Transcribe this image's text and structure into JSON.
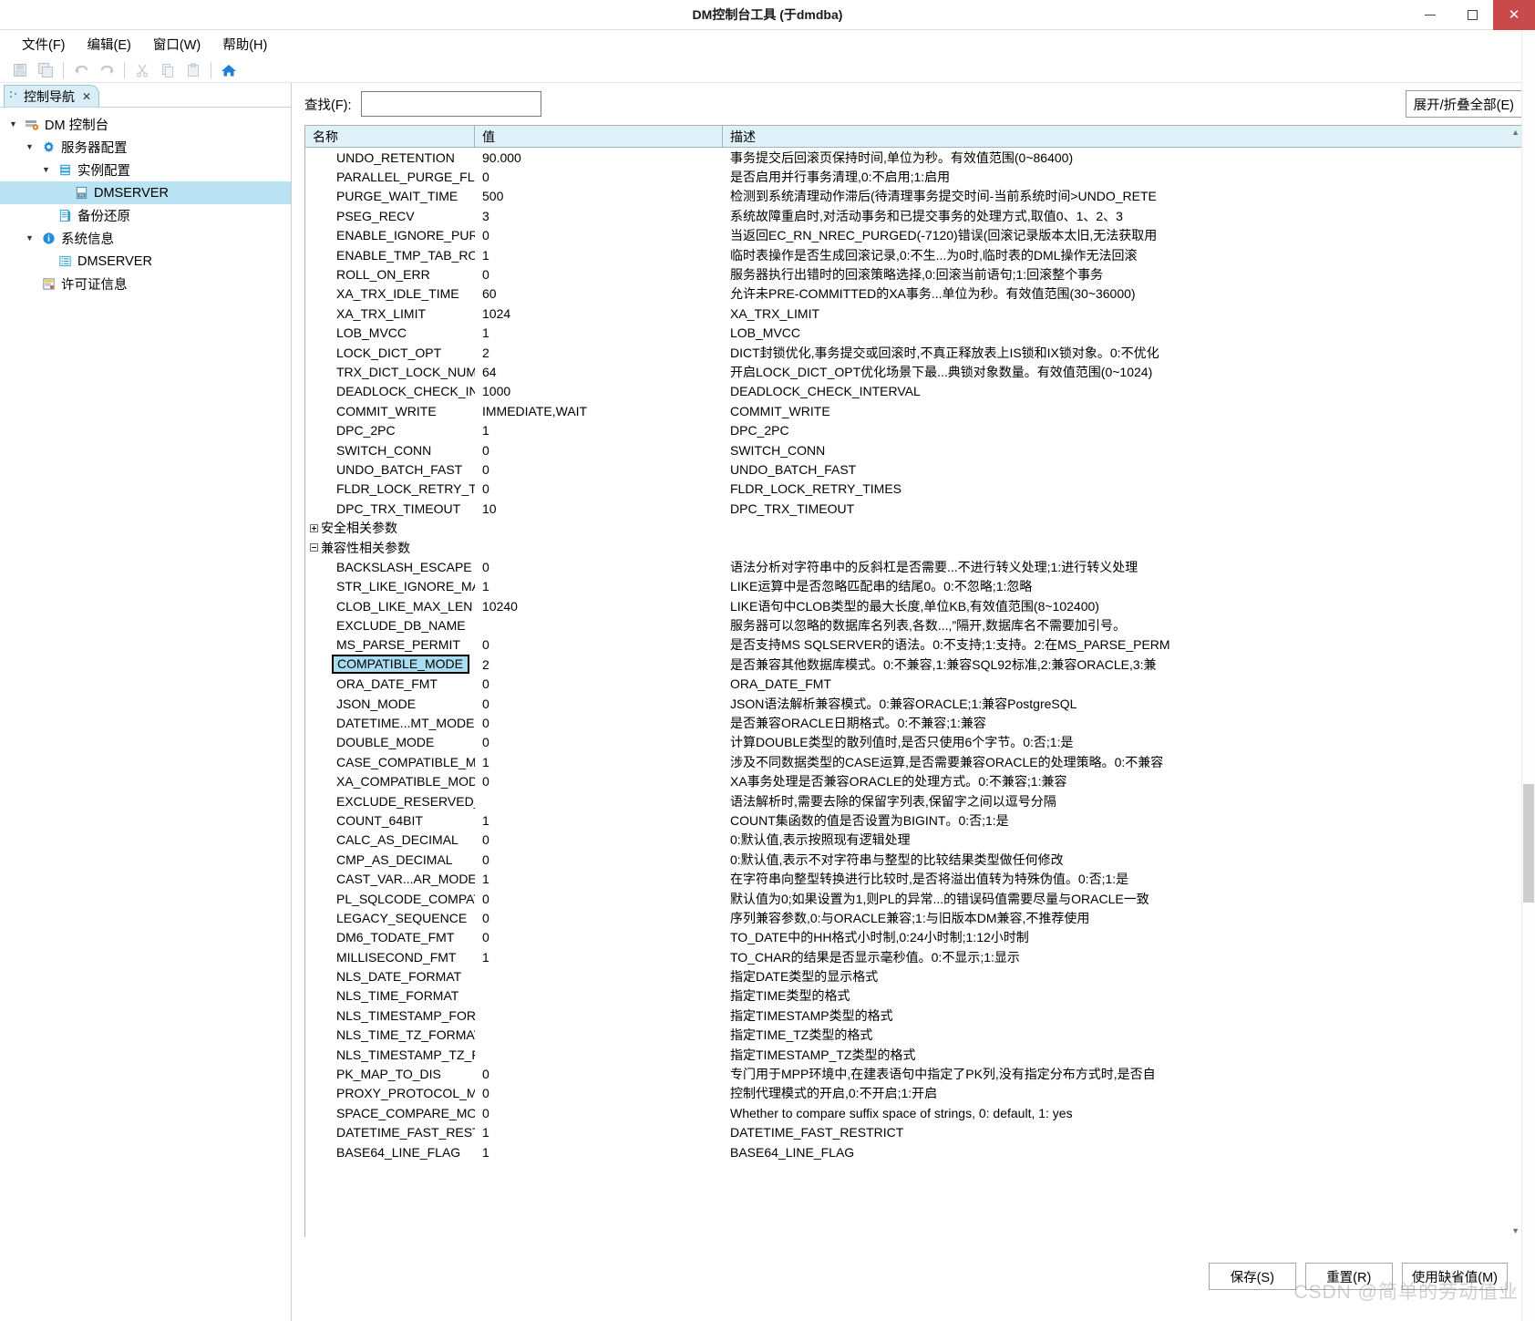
{
  "window": {
    "title": "DM控制台工具 (于dmdba)",
    "minimize_label": "minimize",
    "maximize_label": "maximize",
    "close_label": "✕"
  },
  "menubar": [
    {
      "label": "文件(F)"
    },
    {
      "label": "编辑(E)"
    },
    {
      "label": "窗口(W)"
    },
    {
      "label": "帮助(H)"
    }
  ],
  "toolbar": {
    "items": [
      {
        "icon": "save-icon",
        "enabled": false
      },
      {
        "icon": "save-all-icon",
        "enabled": false
      },
      {
        "icon": "undo-icon",
        "enabled": false
      },
      {
        "icon": "redo-icon",
        "enabled": false
      },
      {
        "icon": "cut-icon",
        "enabled": false
      },
      {
        "icon": "copy-icon",
        "enabled": false
      },
      {
        "icon": "paste-icon",
        "enabled": false
      },
      {
        "icon": "home-icon",
        "enabled": true
      }
    ]
  },
  "sidebar": {
    "tab_label": "控制导航",
    "tab_close": "✕",
    "tree": [
      {
        "label": "DM 控制台",
        "indent": 0,
        "twisty": "▼",
        "icon": "console-icon",
        "selected": false
      },
      {
        "label": "服务器配置",
        "indent": 1,
        "twisty": "▼",
        "icon": "gear-icon",
        "selected": false
      },
      {
        "label": "实例配置",
        "indent": 2,
        "twisty": "▼",
        "icon": "instance-icon",
        "selected": false
      },
      {
        "label": "DMSERVER",
        "indent": 3,
        "twisty": "",
        "icon": "ini-file-icon",
        "selected": true
      },
      {
        "label": "备份还原",
        "indent": 2,
        "twisty": "",
        "icon": "backup-icon",
        "selected": false
      },
      {
        "label": "系统信息",
        "indent": 1,
        "twisty": "▼",
        "icon": "info-icon",
        "selected": false
      },
      {
        "label": "DMSERVER",
        "indent": 2,
        "twisty": "",
        "icon": "list-icon",
        "selected": false
      },
      {
        "label": "许可证信息",
        "indent": 1,
        "twisty": "",
        "icon": "license-icon",
        "selected": false
      }
    ]
  },
  "main": {
    "find_label": "查找(F):",
    "find_value": "",
    "find_placeholder": "",
    "expand_all_label": "展开/折叠全部(E)",
    "columns": {
      "name": "名称",
      "value": "值",
      "desc": "描述"
    },
    "rows": [
      {
        "type": "param",
        "name": "UNDO_RETENTION",
        "value": "90.000",
        "desc": "事务提交后回滚页保持时间,单位为秒。有效值范围(0~86400)"
      },
      {
        "type": "param",
        "name": "PARALLEL_PURGE_FLA.",
        "value": "0",
        "desc": "是否启用并行事务清理,0:不启用;1:启用"
      },
      {
        "type": "param",
        "name": "PURGE_WAIT_TIME",
        "value": "500",
        "desc": "检测到系统清理动作滞后(待清理事务提交时间-当前系统时间>UNDO_RETE"
      },
      {
        "type": "param",
        "name": "PSEG_RECV",
        "value": "3",
        "desc": "系统故障重启时,对活动事务和已提交事务的处理方式,取值0、1、2、3"
      },
      {
        "type": "param",
        "name": "ENABLE_IGNORE_PUR(",
        "value": "0",
        "desc": "当返回EC_RN_NREC_PURGED(-7120)错误(回滚记录版本太旧,无法获取用"
      },
      {
        "type": "param",
        "name": "ENABLE_TMP_TAB_ROl",
        "value": "1",
        "desc": "临时表操作是否生成回滚记录,0:不生...为0时,临时表的DML操作无法回滚"
      },
      {
        "type": "param",
        "name": "ROLL_ON_ERR",
        "value": "0",
        "desc": "服务器执行出错时的回滚策略选择,0:回滚当前语句;1:回滚整个事务"
      },
      {
        "type": "param",
        "name": "XA_TRX_IDLE_TIME",
        "value": "60",
        "desc": "允许未PRE-COMMITTED的XA事务...单位为秒。有效值范围(30~36000)"
      },
      {
        "type": "param",
        "name": "XA_TRX_LIMIT",
        "value": "1024",
        "desc": "XA_TRX_LIMIT"
      },
      {
        "type": "param",
        "name": "LOB_MVCC",
        "value": "1",
        "desc": "LOB_MVCC"
      },
      {
        "type": "param",
        "name": "LOCK_DICT_OPT",
        "value": "2",
        "desc": "DICT封锁优化,事务提交或回滚时,不真正释放表上IS锁和IX锁对象。0:不优化"
      },
      {
        "type": "param",
        "name": "TRX_DICT_LOCK_NUM",
        "value": "64",
        "desc": "开启LOCK_DICT_OPT优化场景下最...典锁对象数量。有效值范围(0~1024)"
      },
      {
        "type": "param",
        "name": "DEADLOCK_CHECK_INT",
        "value": "1000",
        "desc": "DEADLOCK_CHECK_INTERVAL"
      },
      {
        "type": "param",
        "name": "COMMIT_WRITE",
        "value": "IMMEDIATE,WAIT",
        "desc": "COMMIT_WRITE"
      },
      {
        "type": "param",
        "name": "DPC_2PC",
        "value": "1",
        "desc": "DPC_2PC"
      },
      {
        "type": "param",
        "name": "SWITCH_CONN",
        "value": "0",
        "desc": "SWITCH_CONN"
      },
      {
        "type": "param",
        "name": "UNDO_BATCH_FAST",
        "value": "0",
        "desc": "UNDO_BATCH_FAST"
      },
      {
        "type": "param",
        "name": "FLDR_LOCK_RETRY_TI..",
        "value": "0",
        "desc": "FLDR_LOCK_RETRY_TIMES"
      },
      {
        "type": "param",
        "name": "DPC_TRX_TIMEOUT",
        "value": "10",
        "desc": "DPC_TRX_TIMEOUT"
      },
      {
        "type": "group",
        "expanded": false,
        "name": "安全相关参数",
        "value": "",
        "desc": ""
      },
      {
        "type": "group",
        "expanded": true,
        "name": "兼容性相关参数",
        "value": "",
        "desc": ""
      },
      {
        "type": "param",
        "name": "BACKSLASH_ESCAPE",
        "value": "0",
        "desc": "语法分析对字符串中的反斜杠是否需要...不进行转义处理;1:进行转义处理"
      },
      {
        "type": "param",
        "name": "STR_LIKE_IGNORE_MA.",
        "value": "1",
        "desc": "LIKE运算中是否忽略匹配串的结尾0。0:不忽略;1:忽略"
      },
      {
        "type": "param",
        "name": "CLOB_LIKE_MAX_LEN",
        "value": "10240",
        "desc": "LIKE语句中CLOB类型的最大长度,单位KB,有效值范围(8~102400)"
      },
      {
        "type": "param",
        "name": "EXCLUDE_DB_NAME",
        "value": "",
        "desc": "服务器可以忽略的数据库名列表,各数...,”隔开,数据库名不需要加引号。"
      },
      {
        "type": "param",
        "name": "MS_PARSE_PERMIT",
        "value": "0",
        "desc": "是否支持MS SQLSERVER的语法。0:不支持;1:支持。2:在MS_PARSE_PERM"
      },
      {
        "type": "param",
        "name": "COMPATIBLE_MODE",
        "value": "2",
        "desc": "是否兼容其他数据库模式。0:不兼容,1:兼容SQL92标准,2:兼容ORACLE,3:兼",
        "selected": true
      },
      {
        "type": "param",
        "name": "ORA_DATE_FMT",
        "value": "0",
        "desc": "ORA_DATE_FMT"
      },
      {
        "type": "param",
        "name": "JSON_MODE",
        "value": "0",
        "desc": "JSON语法解析兼容模式。0:兼容ORACLE;1:兼容PostgreSQL"
      },
      {
        "type": "param",
        "name": "DATETIME...MT_MODE",
        "value": "0",
        "desc": "是否兼容ORACLE日期格式。0:不兼容;1:兼容"
      },
      {
        "type": "param",
        "name": "DOUBLE_MODE",
        "value": "0",
        "desc": "计算DOUBLE类型的散列值时,是否只使用6个字节。0:否;1:是"
      },
      {
        "type": "param",
        "name": "CASE_COMPATIBLE_M(",
        "value": "1",
        "desc": "涉及不同数据类型的CASE运算,是否需要兼容ORACLE的处理策略。0:不兼容"
      },
      {
        "type": "param",
        "name": "XA_COMPATIBLE_MOD",
        "value": "0",
        "desc": "XA事务处理是否兼容ORACLE的处理方式。0:不兼容;1:兼容"
      },
      {
        "type": "param",
        "name": "EXCLUDE_RESERVED_V",
        "value": "",
        "desc": "语法解析时,需要去除的保留字列表,保留字之间以逗号分隔"
      },
      {
        "type": "param",
        "name": "COUNT_64BIT",
        "value": "1",
        "desc": "COUNT集函数的值是否设置为BIGINT。0:否;1:是"
      },
      {
        "type": "param",
        "name": "CALC_AS_DECIMAL",
        "value": "0",
        "desc": "0:默认值,表示按照现有逻辑处理"
      },
      {
        "type": "param",
        "name": "CMP_AS_DECIMAL",
        "value": "0",
        "desc": "0:默认值,表示不对字符串与整型的比较结果类型做任何修改"
      },
      {
        "type": "param",
        "name": "CAST_VAR...AR_MODE",
        "value": "1",
        "desc": "在字符串向整型转换进行比较时,是否将溢出值转为特殊伪值。0:否;1:是"
      },
      {
        "type": "param",
        "name": "PL_SQLCODE_COMPAT",
        "value": "0",
        "desc": "默认值为0;如果设置为1,则PL的异常...的错误码值需要尽量与ORACLE一致"
      },
      {
        "type": "param",
        "name": "LEGACY_SEQUENCE",
        "value": "0",
        "desc": "序列兼容参数,0:与ORACLE兼容;1:与旧版本DM兼容,不推荐使用"
      },
      {
        "type": "param",
        "name": "DM6_TODATE_FMT",
        "value": "0",
        "desc": "TO_DATE中的HH格式小时制,0:24小时制;1:12小时制"
      },
      {
        "type": "param",
        "name": "MILLISECOND_FMT",
        "value": "1",
        "desc": "TO_CHAR的结果是否显示毫秒值。0:不显示;1:显示"
      },
      {
        "type": "param",
        "name": "NLS_DATE_FORMAT",
        "value": "",
        "desc": "指定DATE类型的显示格式"
      },
      {
        "type": "param",
        "name": "NLS_TIME_FORMAT",
        "value": "",
        "desc": "指定TIME类型的格式"
      },
      {
        "type": "param",
        "name": "NLS_TIMESTAMP_FORM",
        "value": "",
        "desc": "指定TIMESTAMP类型的格式"
      },
      {
        "type": "param",
        "name": "NLS_TIME_TZ_FORMAT",
        "value": "",
        "desc": "指定TIME_TZ类型的格式"
      },
      {
        "type": "param",
        "name": "NLS_TIMESTAMP_TZ_F.",
        "value": "",
        "desc": "指定TIMESTAMP_TZ类型的格式"
      },
      {
        "type": "param",
        "name": "PK_MAP_TO_DIS",
        "value": "0",
        "desc": "专门用于MPP环境中,在建表语句中指定了PK列,没有指定分布方式时,是否自"
      },
      {
        "type": "param",
        "name": "PROXY_PROTOCOL_M(",
        "value": "0",
        "desc": "控制代理模式的开启,0:不开启;1:开启"
      },
      {
        "type": "param",
        "name": "SPACE_COMPARE_MOD",
        "value": "0",
        "desc": "Whether to compare suffix space of strings, 0: default, 1: yes"
      },
      {
        "type": "param",
        "name": "DATETIME_FAST_REST.",
        "value": "1",
        "desc": "DATETIME_FAST_RESTRICT"
      },
      {
        "type": "param",
        "name": "BASE64_LINE_FLAG",
        "value": "1",
        "desc": "BASE64_LINE_FLAG"
      }
    ]
  },
  "footer": {
    "save_label": "保存(S)",
    "reset_label": "重置(R)",
    "default_label": "使用缺省值(M)"
  },
  "watermark": "CSDN @简单的劳动值业",
  "colors": {
    "selection": "#a9ddf2",
    "tab_bg": "#d9edf7",
    "header_bg": "#dff0f8",
    "accent_blue": "#1a73c0",
    "close_red": "#c84a4a"
  }
}
